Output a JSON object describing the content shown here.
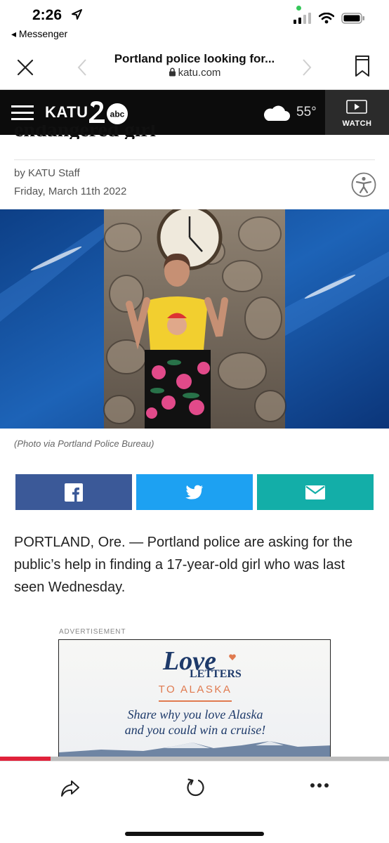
{
  "status_bar": {
    "time": "2:26",
    "back_app": "◂ Messenger"
  },
  "browser": {
    "page_title": "Portland police looking for...",
    "url": "katu.com"
  },
  "site_nav": {
    "logo_text": "KATU",
    "temperature": "55°",
    "watch_label": "WATCH"
  },
  "article": {
    "headline_visible_fragment": "endangered girl",
    "byline": "by KATU Staff",
    "date": "Friday, March 11th 2022",
    "photo_caption": "(Photo via Portland Police Bureau)",
    "body_paragraph": "PORTLAND, Ore. — Portland police are asking for the public’s help in finding a 17-year-old girl who was last seen Wednesday."
  },
  "share_buttons": [
    {
      "network": "facebook",
      "color": "#3b5998"
    },
    {
      "network": "twitter",
      "color": "#1da1f2"
    },
    {
      "network": "email",
      "color": "#13aea8"
    }
  ],
  "advertisement": {
    "label": "ADVERTISEMENT",
    "title_love": "Love",
    "title_letters": "LETTERS",
    "title_to": "TO ALASKA",
    "tagline_line1": "Share why you love Alaska",
    "tagline_line2": "and you could win a cruise!"
  },
  "reading_progress": 0.13,
  "colors": {
    "katu_bar": "#0c0c0c",
    "progress_accent": "#e0223b",
    "photo_background": "#1d63b7"
  }
}
